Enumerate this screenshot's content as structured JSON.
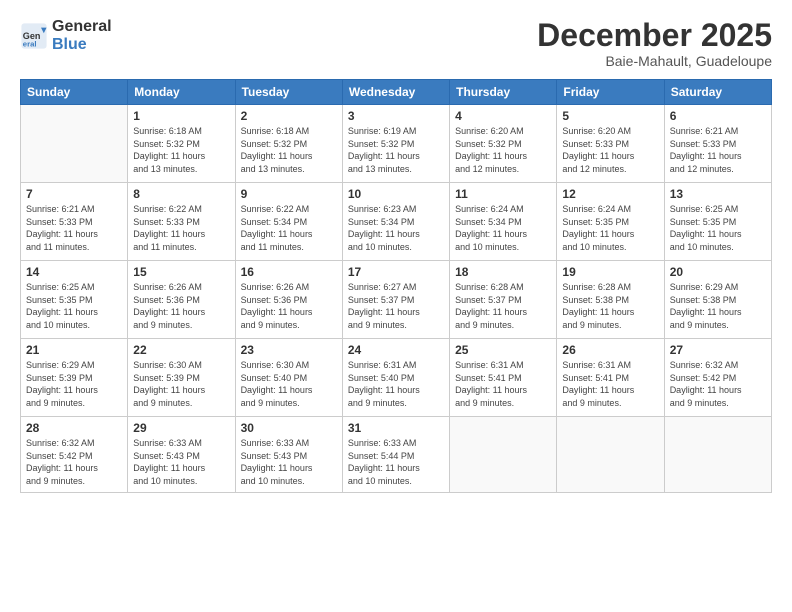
{
  "logo": {
    "general": "General",
    "blue": "Blue"
  },
  "title": "December 2025",
  "location": "Baie-Mahault, Guadeloupe",
  "headers": [
    "Sunday",
    "Monday",
    "Tuesday",
    "Wednesday",
    "Thursday",
    "Friday",
    "Saturday"
  ],
  "weeks": [
    [
      {
        "day": "",
        "info": ""
      },
      {
        "day": "1",
        "info": "Sunrise: 6:18 AM\nSunset: 5:32 PM\nDaylight: 11 hours\nand 13 minutes."
      },
      {
        "day": "2",
        "info": "Sunrise: 6:18 AM\nSunset: 5:32 PM\nDaylight: 11 hours\nand 13 minutes."
      },
      {
        "day": "3",
        "info": "Sunrise: 6:19 AM\nSunset: 5:32 PM\nDaylight: 11 hours\nand 13 minutes."
      },
      {
        "day": "4",
        "info": "Sunrise: 6:20 AM\nSunset: 5:32 PM\nDaylight: 11 hours\nand 12 minutes."
      },
      {
        "day": "5",
        "info": "Sunrise: 6:20 AM\nSunset: 5:33 PM\nDaylight: 11 hours\nand 12 minutes."
      },
      {
        "day": "6",
        "info": "Sunrise: 6:21 AM\nSunset: 5:33 PM\nDaylight: 11 hours\nand 12 minutes."
      }
    ],
    [
      {
        "day": "7",
        "info": "Sunrise: 6:21 AM\nSunset: 5:33 PM\nDaylight: 11 hours\nand 11 minutes."
      },
      {
        "day": "8",
        "info": "Sunrise: 6:22 AM\nSunset: 5:33 PM\nDaylight: 11 hours\nand 11 minutes."
      },
      {
        "day": "9",
        "info": "Sunrise: 6:22 AM\nSunset: 5:34 PM\nDaylight: 11 hours\nand 11 minutes."
      },
      {
        "day": "10",
        "info": "Sunrise: 6:23 AM\nSunset: 5:34 PM\nDaylight: 11 hours\nand 10 minutes."
      },
      {
        "day": "11",
        "info": "Sunrise: 6:24 AM\nSunset: 5:34 PM\nDaylight: 11 hours\nand 10 minutes."
      },
      {
        "day": "12",
        "info": "Sunrise: 6:24 AM\nSunset: 5:35 PM\nDaylight: 11 hours\nand 10 minutes."
      },
      {
        "day": "13",
        "info": "Sunrise: 6:25 AM\nSunset: 5:35 PM\nDaylight: 11 hours\nand 10 minutes."
      }
    ],
    [
      {
        "day": "14",
        "info": "Sunrise: 6:25 AM\nSunset: 5:35 PM\nDaylight: 11 hours\nand 10 minutes."
      },
      {
        "day": "15",
        "info": "Sunrise: 6:26 AM\nSunset: 5:36 PM\nDaylight: 11 hours\nand 9 minutes."
      },
      {
        "day": "16",
        "info": "Sunrise: 6:26 AM\nSunset: 5:36 PM\nDaylight: 11 hours\nand 9 minutes."
      },
      {
        "day": "17",
        "info": "Sunrise: 6:27 AM\nSunset: 5:37 PM\nDaylight: 11 hours\nand 9 minutes."
      },
      {
        "day": "18",
        "info": "Sunrise: 6:28 AM\nSunset: 5:37 PM\nDaylight: 11 hours\nand 9 minutes."
      },
      {
        "day": "19",
        "info": "Sunrise: 6:28 AM\nSunset: 5:38 PM\nDaylight: 11 hours\nand 9 minutes."
      },
      {
        "day": "20",
        "info": "Sunrise: 6:29 AM\nSunset: 5:38 PM\nDaylight: 11 hours\nand 9 minutes."
      }
    ],
    [
      {
        "day": "21",
        "info": "Sunrise: 6:29 AM\nSunset: 5:39 PM\nDaylight: 11 hours\nand 9 minutes."
      },
      {
        "day": "22",
        "info": "Sunrise: 6:30 AM\nSunset: 5:39 PM\nDaylight: 11 hours\nand 9 minutes."
      },
      {
        "day": "23",
        "info": "Sunrise: 6:30 AM\nSunset: 5:40 PM\nDaylight: 11 hours\nand 9 minutes."
      },
      {
        "day": "24",
        "info": "Sunrise: 6:31 AM\nSunset: 5:40 PM\nDaylight: 11 hours\nand 9 minutes."
      },
      {
        "day": "25",
        "info": "Sunrise: 6:31 AM\nSunset: 5:41 PM\nDaylight: 11 hours\nand 9 minutes."
      },
      {
        "day": "26",
        "info": "Sunrise: 6:31 AM\nSunset: 5:41 PM\nDaylight: 11 hours\nand 9 minutes."
      },
      {
        "day": "27",
        "info": "Sunrise: 6:32 AM\nSunset: 5:42 PM\nDaylight: 11 hours\nand 9 minutes."
      }
    ],
    [
      {
        "day": "28",
        "info": "Sunrise: 6:32 AM\nSunset: 5:42 PM\nDaylight: 11 hours\nand 9 minutes."
      },
      {
        "day": "29",
        "info": "Sunrise: 6:33 AM\nSunset: 5:43 PM\nDaylight: 11 hours\nand 10 minutes."
      },
      {
        "day": "30",
        "info": "Sunrise: 6:33 AM\nSunset: 5:43 PM\nDaylight: 11 hours\nand 10 minutes."
      },
      {
        "day": "31",
        "info": "Sunrise: 6:33 AM\nSunset: 5:44 PM\nDaylight: 11 hours\nand 10 minutes."
      },
      {
        "day": "",
        "info": ""
      },
      {
        "day": "",
        "info": ""
      },
      {
        "day": "",
        "info": ""
      }
    ]
  ]
}
